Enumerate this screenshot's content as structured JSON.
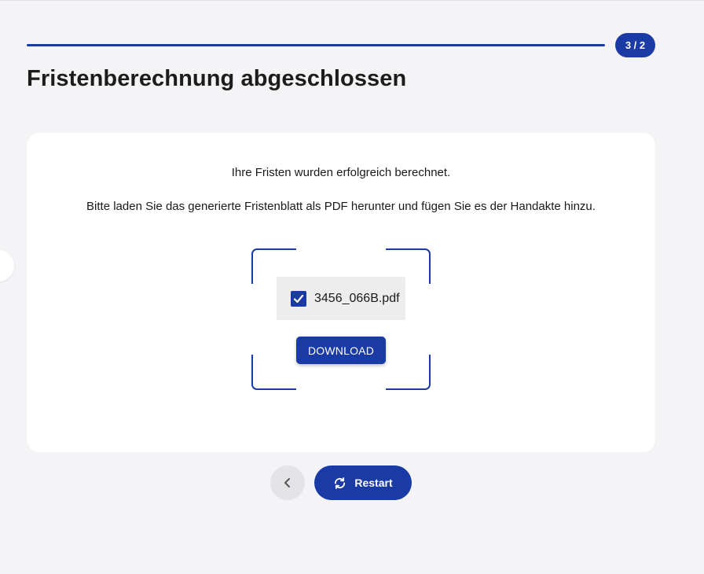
{
  "progress": {
    "step_label": "3 / 2"
  },
  "page": {
    "title": "Fristenberechnung abgeschlossen"
  },
  "card": {
    "message_success": "Ihre Fristen wurden erfolgreich berechnet.",
    "message_instruction": "Bitte laden Sie das generierte Fristenblatt als PDF herunter und fügen Sie es der Handakte hinzu.",
    "file": {
      "name": "3456_066B.pdf",
      "checked": true
    },
    "download_label": "DOWNLOAD"
  },
  "navigation": {
    "back_icon": "chevron-left-icon",
    "restart_label": "Restart",
    "restart_icon": "refresh-icon"
  },
  "colors": {
    "accent": "#1a3aa5",
    "background": "#f4f4f7",
    "card": "#ffffff",
    "file_box": "#ededed",
    "back_button": "#e4e4e7"
  }
}
